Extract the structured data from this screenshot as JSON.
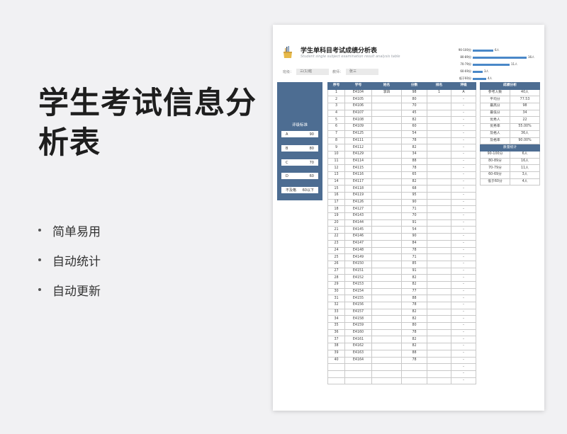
{
  "hero": {
    "title": "学生考试信息分析表"
  },
  "bullets": [
    "简单易用",
    "自动统计",
    "自动更新"
  ],
  "sheet": {
    "title": "学生单科目考试成绩分析表",
    "subtitle": "Student single subject examination result analysis table",
    "class_label": "班级：",
    "class_value": "三(1)班",
    "teacher_label": "教师：",
    "teacher_value": "张三"
  },
  "mini_chart": {
    "type": "bar",
    "categories": [
      "90-100分",
      "80-89分",
      "70-79分",
      "60-69分",
      "低于60分"
    ],
    "values": [
      6,
      16,
      11,
      3,
      4
    ],
    "value_labels": [
      "6人",
      "16人",
      "11人",
      "3人",
      "4人"
    ],
    "bar_color": "#4a88c8"
  },
  "criteria": {
    "title": "评级标准",
    "rows": [
      {
        "grade": "A",
        "score": "90"
      },
      {
        "grade": "B",
        "score": "80"
      },
      {
        "grade": "C",
        "score": "70"
      },
      {
        "grade": "D",
        "score": "60"
      },
      {
        "grade": "不及格",
        "score": "60以下"
      }
    ]
  },
  "main_table": {
    "headers": [
      "序号",
      "学号",
      "姓名",
      "分数",
      "排名",
      "评级"
    ],
    "rows": [
      [
        "1",
        "E4104",
        "李四",
        "98",
        "1",
        "A"
      ],
      [
        "2",
        "E4105",
        "",
        "80",
        "",
        "-"
      ],
      [
        "3",
        "E4106",
        "",
        "70",
        "",
        "-"
      ],
      [
        "4",
        "E4107",
        "",
        "45",
        "",
        "-"
      ],
      [
        "5",
        "E4108",
        "",
        "82",
        "",
        "-"
      ],
      [
        "6",
        "E4109",
        "",
        "60",
        "",
        "-"
      ],
      [
        "7",
        "E4125",
        "",
        "54",
        "",
        "-"
      ],
      [
        "8",
        "E4111",
        "",
        "78",
        "",
        "-"
      ],
      [
        "9",
        "E4112",
        "",
        "82",
        "",
        "-"
      ],
      [
        "10",
        "E4129",
        "",
        "34",
        "",
        "-"
      ],
      [
        "11",
        "E4114",
        "",
        "88",
        "",
        "-"
      ],
      [
        "12",
        "E4115",
        "",
        "78",
        "",
        "-"
      ],
      [
        "13",
        "E4116",
        "",
        "65",
        "",
        "-"
      ],
      [
        "14",
        "E4117",
        "",
        "82",
        "",
        "-"
      ],
      [
        "15",
        "E4118",
        "",
        "68",
        "",
        "-"
      ],
      [
        "16",
        "E4119",
        "",
        "95",
        "",
        "-"
      ],
      [
        "17",
        "E4126",
        "",
        "90",
        "",
        "-"
      ],
      [
        "18",
        "E4127",
        "",
        "71",
        "",
        "-"
      ],
      [
        "19",
        "E4143",
        "",
        "70",
        "",
        "-"
      ],
      [
        "20",
        "E4144",
        "",
        "91",
        "",
        "-"
      ],
      [
        "21",
        "E4145",
        "",
        "54",
        "",
        "-"
      ],
      [
        "22",
        "E4146",
        "",
        "90",
        "",
        "-"
      ],
      [
        "23",
        "E4147",
        "",
        "84",
        "",
        "-"
      ],
      [
        "24",
        "E4148",
        "",
        "78",
        "",
        "-"
      ],
      [
        "25",
        "E4149",
        "",
        "71",
        "",
        "-"
      ],
      [
        "26",
        "E4150",
        "",
        "85",
        "",
        "-"
      ],
      [
        "27",
        "E4151",
        "",
        "91",
        "",
        "-"
      ],
      [
        "28",
        "E4152",
        "",
        "82",
        "",
        "-"
      ],
      [
        "29",
        "E4153",
        "",
        "82",
        "",
        "-"
      ],
      [
        "30",
        "E4154",
        "",
        "77",
        "",
        "-"
      ],
      [
        "31",
        "E4155",
        "",
        "88",
        "",
        "-"
      ],
      [
        "32",
        "E4156",
        "",
        "78",
        "",
        "-"
      ],
      [
        "33",
        "E4157",
        "",
        "82",
        "",
        "-"
      ],
      [
        "34",
        "E4158",
        "",
        "82",
        "",
        "-"
      ],
      [
        "35",
        "E4159",
        "",
        "80",
        "",
        "-"
      ],
      [
        "36",
        "E4160",
        "",
        "78",
        "",
        "-"
      ],
      [
        "37",
        "E4161",
        "",
        "82",
        "",
        "-"
      ],
      [
        "38",
        "E4162",
        "",
        "82",
        "",
        "-"
      ],
      [
        "39",
        "E4163",
        "",
        "88",
        "",
        "-"
      ],
      [
        "40",
        "E4164",
        "",
        "78",
        "",
        "-"
      ],
      [
        "",
        "",
        "",
        "",
        "",
        "-"
      ],
      [
        "",
        "",
        "",
        "",
        "",
        "-"
      ],
      [
        "",
        "",
        "",
        "",
        "",
        "-"
      ]
    ]
  },
  "stats": {
    "header": "成绩分析",
    "rows": [
      [
        "参考人数",
        "40人"
      ],
      [
        "平均分",
        "77.53"
      ],
      [
        "最高分",
        "98"
      ],
      [
        "最低分",
        "34"
      ],
      [
        "优秀人",
        "22"
      ],
      [
        "优秀率",
        "55.00%"
      ],
      [
        "及格人",
        "36人"
      ],
      [
        "及格率",
        "90.00%"
      ]
    ],
    "section2": "质量统计",
    "rows2": [
      [
        "90-100分",
        "6人"
      ],
      [
        "80-89分",
        "16人"
      ],
      [
        "70-79分",
        "11人"
      ],
      [
        "60-69分",
        "3人"
      ],
      [
        "低于60分",
        "4人"
      ]
    ]
  }
}
